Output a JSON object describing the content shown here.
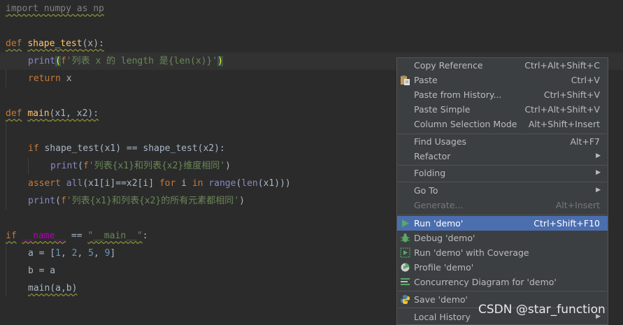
{
  "editor": {
    "l1": "import numpy as np",
    "l3": {
      "kw": "def",
      "name": "shape_test",
      "args": "(x):"
    },
    "l4": {
      "print": "print",
      "open": "(",
      "f": "f",
      "str": "'列表 x 的 length 是",
      "expr": "{len(x)}",
      "end": "'",
      "close": ")"
    },
    "l5": {
      "kw": "return",
      "rest": " x"
    },
    "l7": {
      "kw": "def",
      "name": "main",
      "args": "(x1, x2):"
    },
    "l9": {
      "kw": "if",
      "rest": " shape_test(x1) == shape_test(x2):"
    },
    "l10": {
      "print": "print",
      "open": "(",
      "f": "f",
      "s1": "'列表",
      "e1": "{x1}",
      "s2": "和列表",
      "e2": "{x2}",
      "s3": "维度相同'",
      "close": ")"
    },
    "l11": {
      "kw": "assert",
      "bi1": "all",
      "p1": "(x1[i]==x2[i] ",
      "kw2": "for",
      "p2": " i ",
      "kw3": "in",
      "bi2": "range",
      "p3": "(",
      "bi3": "len",
      "p4": "(x1)))"
    },
    "l12": {
      "print": "print",
      "open": "(",
      "f": "f",
      "s1": "'列表",
      "e1": "{x1}",
      "s2": "和列表",
      "e2": "{x2}",
      "s3": "的所有元素都相同'",
      "close": ")"
    },
    "l14": {
      "kw": "if",
      "name": "__name__",
      "eq": " == ",
      "str": "\"__main__\"",
      "colon": ":"
    },
    "l15": {
      "a": "a = [",
      "n1": "1",
      "c1": ", ",
      "n2": "2",
      "c2": ", ",
      "n3": "5",
      "c3": ", ",
      "n4": "9",
      "close": "]"
    },
    "l16": "b = a",
    "l17": "main(a,b)"
  },
  "context_menu": {
    "items": [
      {
        "label": "Copy Reference",
        "shortcut": "Ctrl+Alt+Shift+C"
      },
      {
        "label": "Paste",
        "shortcut": "Ctrl+V",
        "icon": "clipboard-icon"
      },
      {
        "label": "Paste from History...",
        "shortcut": "Ctrl+Shift+V"
      },
      {
        "label": "Paste Simple",
        "shortcut": "Ctrl+Alt+Shift+V"
      },
      {
        "label": "Column Selection Mode",
        "shortcut": "Alt+Shift+Insert"
      },
      {
        "label": "Find Usages",
        "shortcut": "Alt+F7"
      },
      {
        "label": "Refactor",
        "submenu": true
      },
      {
        "label": "Folding",
        "submenu": true
      },
      {
        "label": "Go To",
        "submenu": true
      },
      {
        "label": "Generate...",
        "shortcut": "Alt+Insert",
        "disabled": true
      },
      {
        "label": "Run 'demo'",
        "shortcut": "Ctrl+Shift+F10",
        "icon": "run-icon",
        "selected": true
      },
      {
        "label": "Debug 'demo'",
        "icon": "debug-icon"
      },
      {
        "label": "Run 'demo' with Coverage",
        "icon": "coverage-icon"
      },
      {
        "label": "Profile 'demo'",
        "icon": "profile-icon"
      },
      {
        "label": "Concurrency Diagram for  'demo'",
        "icon": "concurrency-icon"
      },
      {
        "label": "Save 'demo'",
        "icon": "python-icon"
      },
      {
        "label": "Local History",
        "submenu": true
      }
    ]
  },
  "colors": {
    "selection": "#4b6eaf",
    "menu_bg": "#3c3f41",
    "editor_bg": "#2b2b2b",
    "run_green": "#59a869"
  },
  "watermark": "CSDN @star_function"
}
